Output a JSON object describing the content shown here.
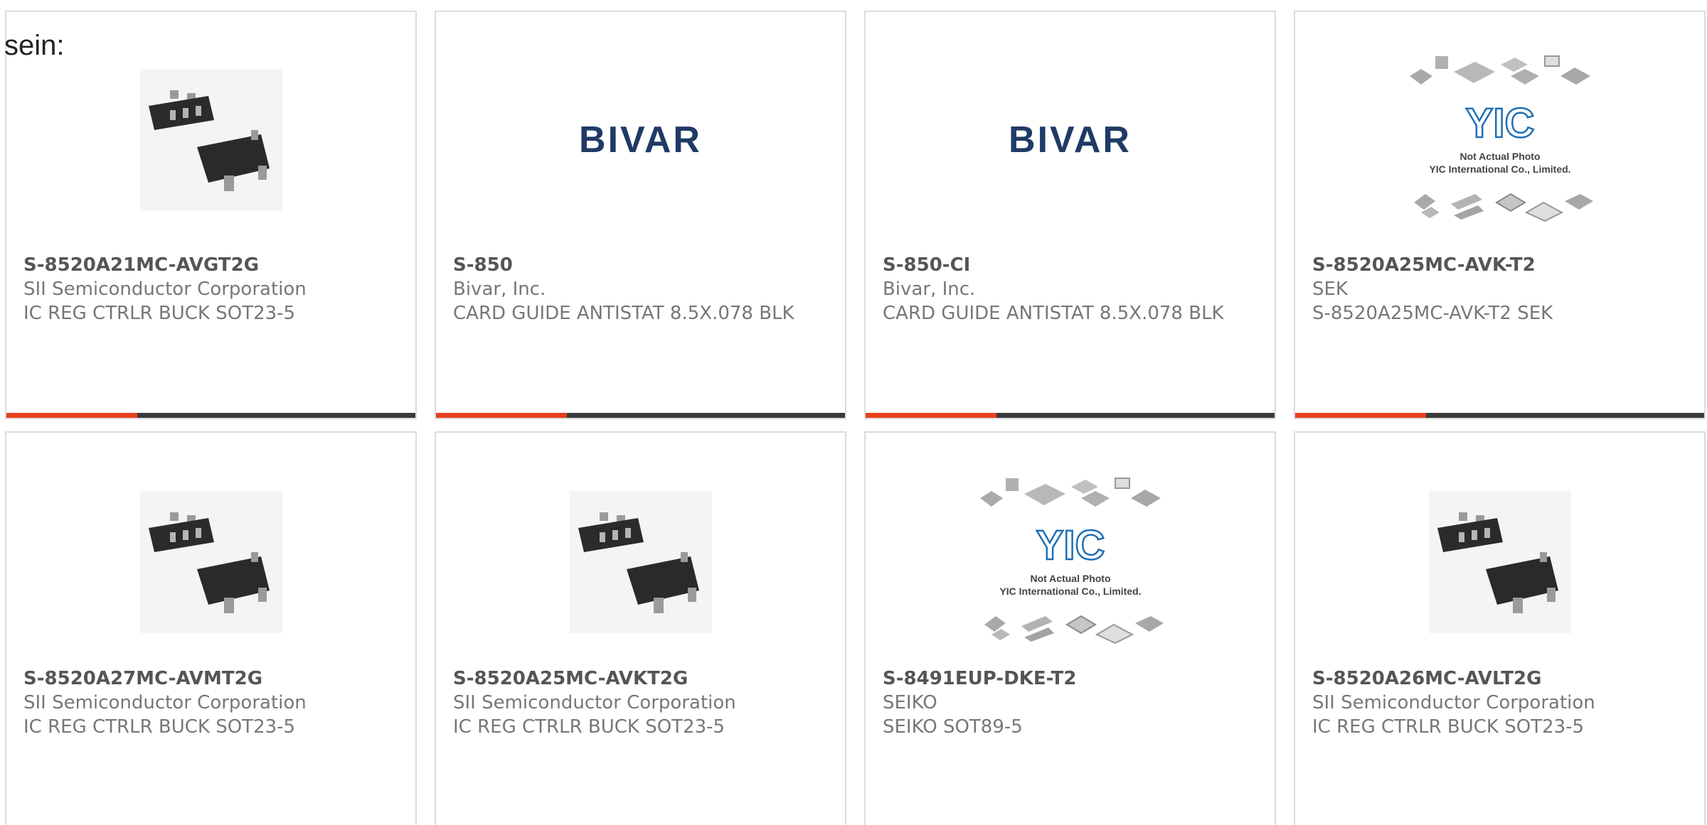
{
  "intro_text": "sein:",
  "accent_color": "#e8401d",
  "bar_color": "#3b3b3b",
  "products": [
    {
      "part": "S-8520A21MC-AVGT2G",
      "manufacturer": "SII Semiconductor Corporation",
      "description": "IC REG CTRLR BUCK SOT23-5",
      "image": "sot23-5-package"
    },
    {
      "part": "S-850",
      "manufacturer": "Bivar, Inc.",
      "description": "CARD GUIDE ANTISTAT 8.5X.078 BLK",
      "image": "bivar-logo",
      "logo_text": "BIVAR"
    },
    {
      "part": "S-850-CI",
      "manufacturer": "Bivar, Inc.",
      "description": "CARD GUIDE ANTISTAT 8.5X.078 BLK",
      "image": "bivar-logo",
      "logo_text": "BIVAR"
    },
    {
      "part": "S-8520A25MC-AVK-T2",
      "manufacturer": "SEK",
      "description": "S-8520A25MC-AVK-T2 SEK",
      "image": "yic-not-actual-photo",
      "logo_text": "YIC",
      "caption_line1": "Not Actual Photo",
      "caption_line2": "YIC International Co., Limited."
    },
    {
      "part": "S-8520A27MC-AVMT2G",
      "manufacturer": "SII Semiconductor Corporation",
      "description": "IC REG CTRLR BUCK SOT23-5",
      "image": "sot23-5-package"
    },
    {
      "part": "S-8520A25MC-AVKT2G",
      "manufacturer": "SII Semiconductor Corporation",
      "description": "IC REG CTRLR BUCK SOT23-5",
      "image": "sot23-5-package"
    },
    {
      "part": "S-8491EUP-DKE-T2",
      "manufacturer": "SEIKO",
      "description": "SEIKO SOT89-5",
      "image": "yic-not-actual-photo",
      "logo_text": "YIC",
      "caption_line1": "Not Actual Photo",
      "caption_line2": "YIC International Co., Limited."
    },
    {
      "part": "S-8520A26MC-AVLT2G",
      "manufacturer": "SII Semiconductor Corporation",
      "description": "IC REG CTRLR BUCK SOT23-5",
      "image": "sot23-5-package"
    }
  ]
}
